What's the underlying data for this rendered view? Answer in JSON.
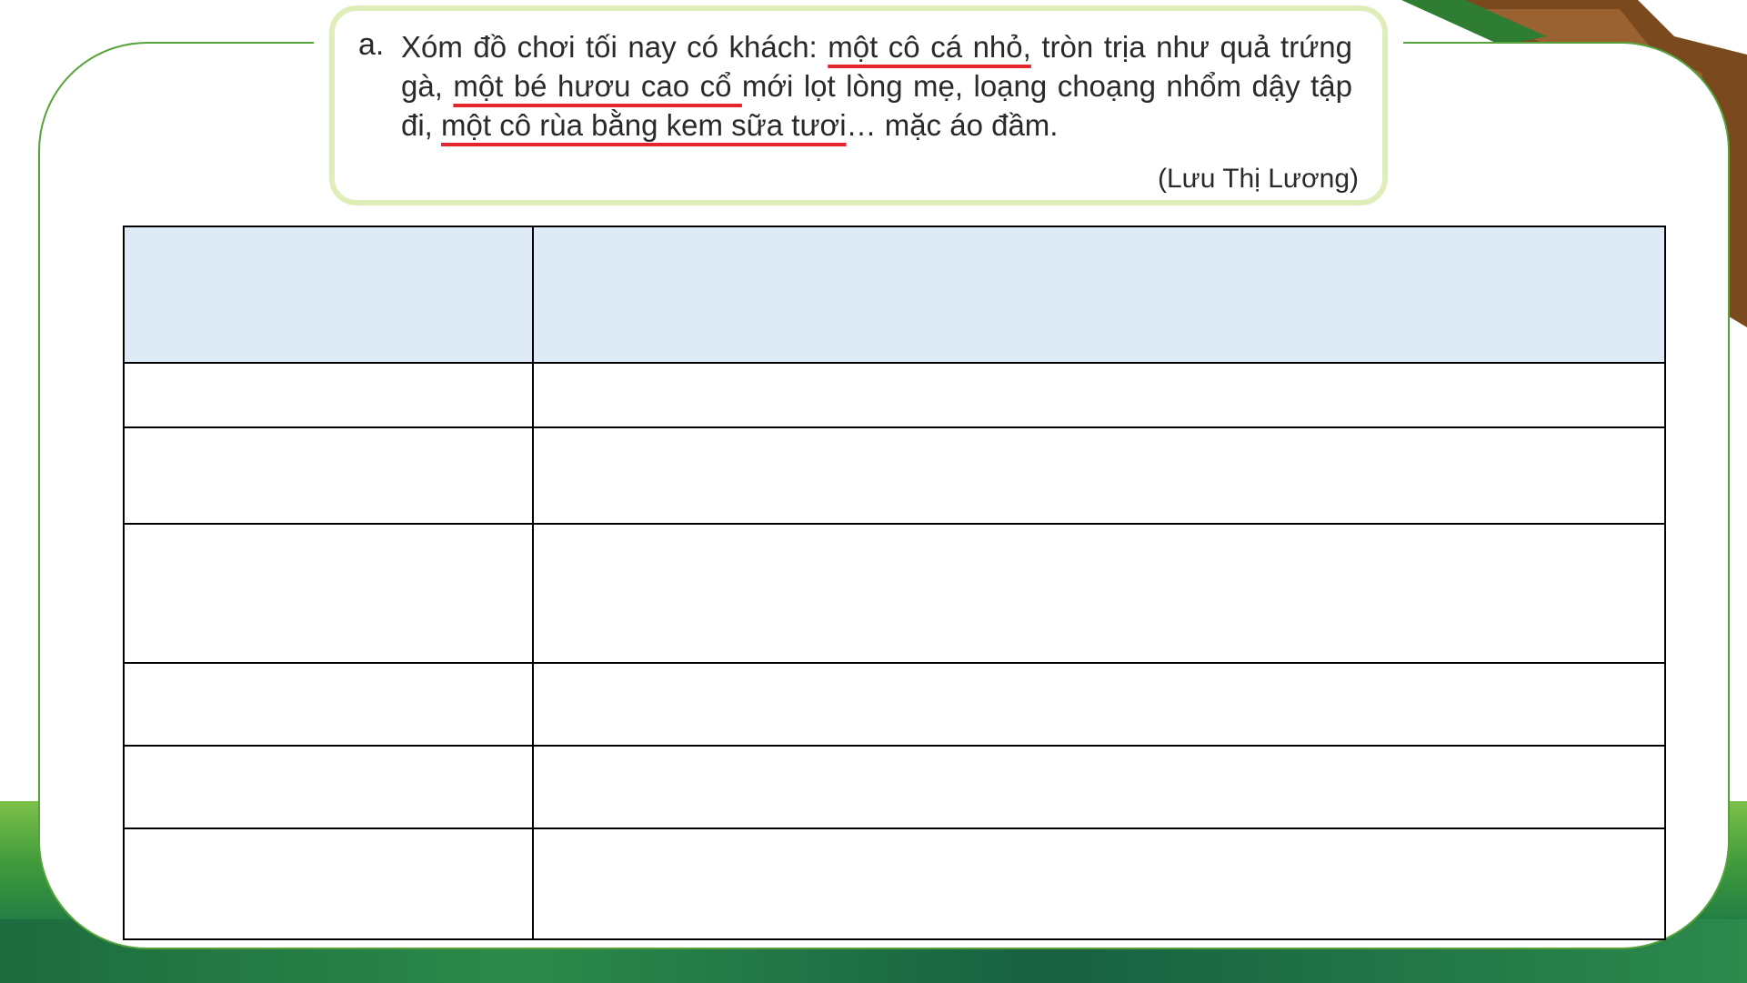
{
  "exercise": {
    "label": "a.",
    "segments": [
      {
        "text": "Xóm đồ chơi tối nay có khách: ",
        "underline": false
      },
      {
        "text": "một cô cá nhỏ,",
        "underline": true
      },
      {
        "text": " tròn trịa như quả trứng gà, ",
        "underline": false
      },
      {
        "text": "một bé hươu cao cổ ",
        "underline": true
      },
      {
        "text": "mới lọt lòng mẹ, loạng choạng nhổm dậy tập đi, ",
        "underline": false
      },
      {
        "text": "một cô rùa bằng kem sữa tươi",
        "underline": true
      },
      {
        "text": "… mặc áo đầm.",
        "underline": false
      }
    ],
    "author": "(Lưu Thị Lương)",
    "underline_color": "#e2262b"
  },
  "table": {
    "rows": [
      [
        "",
        ""
      ],
      [
        "",
        ""
      ],
      [
        "",
        ""
      ],
      [
        "",
        ""
      ],
      [
        "",
        ""
      ],
      [
        "",
        ""
      ],
      [
        "",
        ""
      ]
    ]
  }
}
